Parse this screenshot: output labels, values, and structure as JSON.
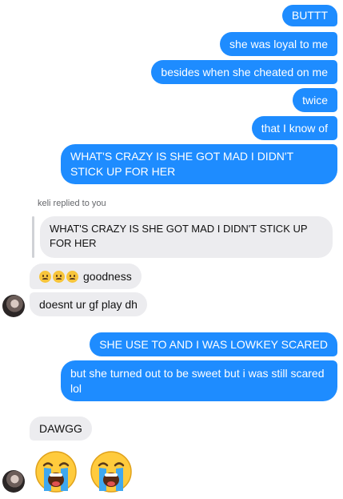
{
  "thread": {
    "sent_group_1": [
      "BUTTT",
      "she was loyal to me",
      "besides when she cheated on me",
      "twice",
      "that I know of",
      "WHAT'S CRAZY IS SHE GOT MAD I DIDN'T STICK UP FOR HER"
    ],
    "reply": {
      "caption": "keli replied to you",
      "quoted_text": "WHAT'S CRAZY IS SHE GOT MAD I DIDN'T STICK UP FOR HER"
    },
    "received_group_1": [
      "goodness",
      "doesnt ur gf play dh"
    ],
    "sent_group_2": [
      "SHE USE TO AND I WAS LOWKEY SCARED",
      "but she turned out to be sweet but i was still scared lol"
    ],
    "received_group_2": [
      "DAWGG"
    ],
    "icons": {
      "worried_face": "worried-face-emoji",
      "crying_face": "loudly-crying-face-emoji",
      "avatar": "contact-avatar"
    },
    "colors": {
      "sent_bubble": "#1e8cff",
      "received_bubble": "#ececef"
    }
  }
}
